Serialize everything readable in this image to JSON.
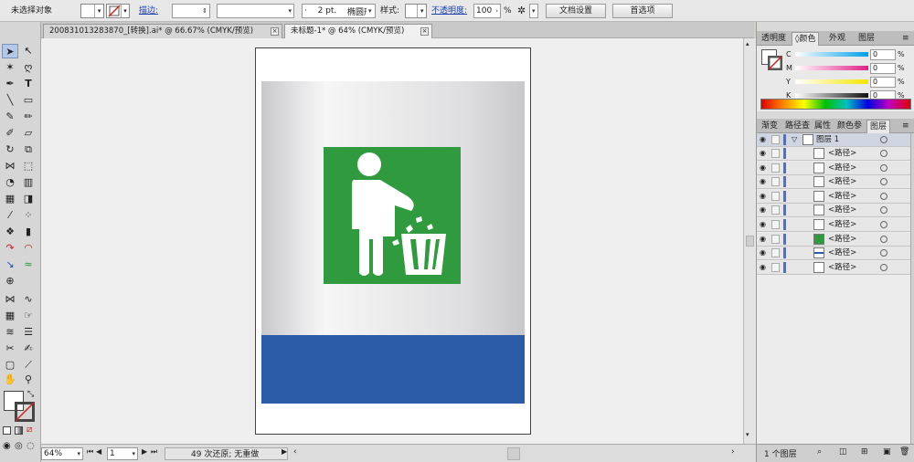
{
  "control_bar": {
    "selection_label": "未选择对象",
    "stroke_label": "描边:",
    "stroke_weight_value": "",
    "brush_size": "2 pt.",
    "brush_style": "椭圆形",
    "style_label": "样式:",
    "opacity_label": "不透明度:",
    "opacity_value": "100",
    "opacity_unit": "%",
    "doc_setup_button": "文档设置",
    "preferences_button": "首选项"
  },
  "tabs": [
    {
      "label": "200831013283870_[转换].ai* @ 66.67% (CMYK/预览)",
      "active": false
    },
    {
      "label": "未标题-1* @ 64% (CMYK/预览)",
      "active": true
    }
  ],
  "colors": {
    "sign_green": "#2f9a3e",
    "sign_blue": "#2c5ca8"
  },
  "status_bar": {
    "zoom": "64%",
    "page": "1",
    "history": "49 次还原; 无重做"
  },
  "color_panel": {
    "tabs": [
      "透明度",
      "颜色",
      "外观",
      "图层"
    ],
    "active_tab": "颜色",
    "channels": [
      {
        "label": "C",
        "value": "0"
      },
      {
        "label": "M",
        "value": "0"
      },
      {
        "label": "Y",
        "value": "0"
      },
      {
        "label": "K",
        "value": "0"
      }
    ],
    "unit": "%"
  },
  "layers_panel": {
    "tabs": [
      "渐变",
      "路径查",
      "属性",
      "颜色参",
      "图层"
    ],
    "active_tab": "图层",
    "layer_name": "图层 1",
    "items": [
      {
        "name": "<路径>",
        "thumb": "white"
      },
      {
        "name": "<路径>",
        "thumb": "white"
      },
      {
        "name": "<路径>",
        "thumb": "white"
      },
      {
        "name": "<路径>",
        "thumb": "white"
      },
      {
        "name": "<路径>",
        "thumb": "white"
      },
      {
        "name": "<路径>",
        "thumb": "white"
      },
      {
        "name": "<路径>",
        "thumb": "green"
      },
      {
        "name": "<路径>",
        "thumb": "blue-stripe"
      },
      {
        "name": "<路径>",
        "thumb": "white"
      }
    ],
    "footer_count": "1 个图层"
  }
}
